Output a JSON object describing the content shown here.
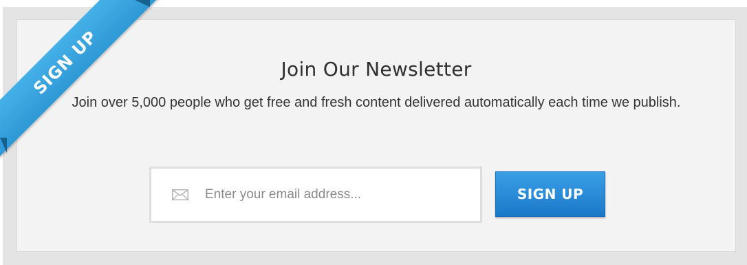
{
  "ribbon": {
    "label": "SIGN UP"
  },
  "newsletter": {
    "title": "Join Our Newsletter",
    "description": "Join over 5,000 people who get free and fresh content delivered automatically each time we publish."
  },
  "form": {
    "email_placeholder": "Enter your email address...",
    "email_value": "",
    "submit_label": "SIGN UP",
    "email_icon": "envelope-icon"
  },
  "colors": {
    "accent": "#2e98d6",
    "button": "#1f80cf",
    "panel": "#f3f3f3",
    "frame": "#e4e4e4"
  }
}
